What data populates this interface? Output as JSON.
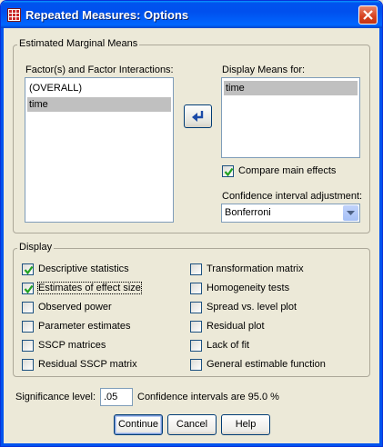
{
  "window": {
    "title": "Repeated Measures: Options"
  },
  "emm": {
    "legend": "Estimated Marginal Means",
    "factors_label": "Factor(s) and Factor Interactions:",
    "factors": [
      {
        "label": "(OVERALL)",
        "selected": false
      },
      {
        "label": "time",
        "selected": true
      }
    ],
    "display_means_label": "Display Means for:",
    "display_means": [
      {
        "label": "time",
        "selected": true
      }
    ],
    "compare_main_effects": {
      "label": "Compare main effects",
      "checked": true
    },
    "ci_adjustment_label": "Confidence interval adjustment:",
    "ci_adjustment_value": "Bonferroni"
  },
  "display": {
    "legend": "Display",
    "left": [
      {
        "label": "Descriptive statistics",
        "checked": true
      },
      {
        "label": "Estimates of effect size",
        "checked": true
      },
      {
        "label": "Observed power",
        "checked": false
      },
      {
        "label": "Parameter estimates",
        "checked": false
      },
      {
        "label": "SSCP matrices",
        "checked": false
      },
      {
        "label": "Residual SSCP matrix",
        "checked": false
      }
    ],
    "right": [
      {
        "label": "Transformation matrix",
        "checked": false
      },
      {
        "label": "Homogeneity tests",
        "checked": false
      },
      {
        "label": "Spread vs. level plot",
        "checked": false
      },
      {
        "label": "Residual plot",
        "checked": false
      },
      {
        "label": "Lack of fit",
        "checked": false
      },
      {
        "label": "General estimable function",
        "checked": false
      }
    ]
  },
  "significance": {
    "label": "Significance level:",
    "value": ".05",
    "ci_text": "Confidence intervals are 95.0 %"
  },
  "buttons": {
    "continue": "Continue",
    "cancel": "Cancel",
    "help": "Help"
  },
  "colors": {
    "titlebar": "#0053ee",
    "selection": "#c0c0c0",
    "dialog_bg": "#ece9d8"
  }
}
